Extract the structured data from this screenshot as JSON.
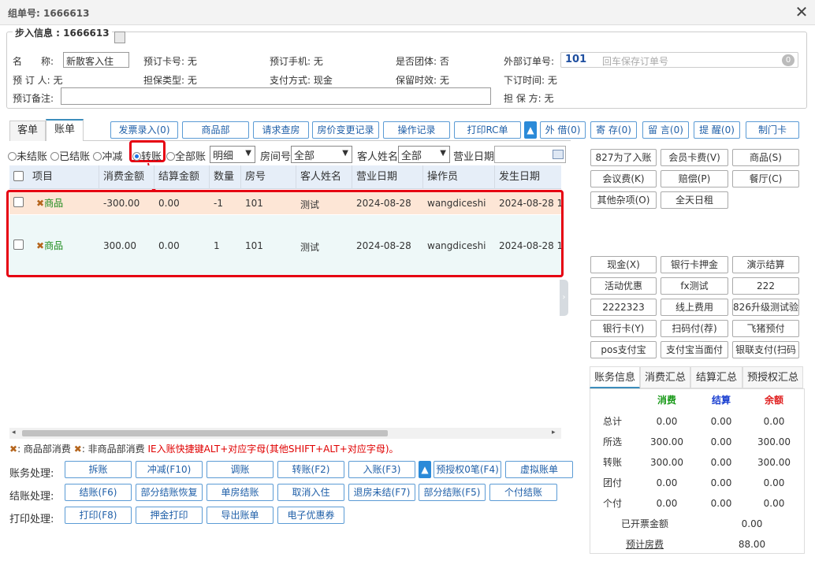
{
  "window": {
    "title": "组单号: 1666613",
    "close_glyph": "✕"
  },
  "checkin": {
    "legend": "步入信息 : 1666613",
    "name_label": "名　　称:",
    "name_value": "新散客入住",
    "card_label": "预订卡号: 无",
    "phone_label": "预订手机: 无",
    "group_label": "是否团体: 否",
    "ext_order_label": "外部订单号:",
    "ext_order_value": "101",
    "ext_order_placeholder": "回车保存订单号",
    "ext_order_badge": "0",
    "booker_label": "预 订 人: 无",
    "guarantee_type_label": "担保类型: 无",
    "pay_label": "支付方式: 现金",
    "retain_label": "保留时效: 无",
    "order_time_label": "下订时间: 无",
    "remark_label": "预订备注:",
    "guarantor_label": "担 保 方: 无"
  },
  "tabs": [
    {
      "label": "客单"
    },
    {
      "label": "账单"
    }
  ],
  "toolbar": [
    "发票录入(0)",
    "商品部",
    "请求查房",
    "房价变更记录",
    "操作记录",
    "打印RC单",
    "外 借(0)",
    "寄 存(0)",
    "留 言(0)",
    "提 醒(0)",
    "制门卡"
  ],
  "filters": {
    "radios": [
      "未结账",
      "已结账",
      "冲减",
      "转账",
      "全部账"
    ],
    "detail_select": "明细",
    "room_label": "房间号",
    "room_select": "全部",
    "guest_label": "客人姓名",
    "guest_select": "全部",
    "bizdate_label": "营业日期"
  },
  "grid": {
    "columns": [
      "项目",
      "消费金额",
      "结算金额",
      "数量",
      "房号",
      "客人姓名",
      "营业日期",
      "操作员",
      "发生日期"
    ],
    "rows": [
      {
        "item": "商品",
        "amount": "-300.00",
        "settle": "0.00",
        "qty": "-1",
        "room": "101",
        "guest": "测试",
        "bizdate": "2024-08-28",
        "operator": "wangdiceshi",
        "date": "2024-08-28 1"
      },
      {
        "item": "商品",
        "amount": "300.00",
        "settle": "0.00",
        "qty": "1",
        "room": "101",
        "guest": "测试",
        "bizdate": "2024-08-28",
        "operator": "wangdiceshi",
        "date": "2024-08-28 1"
      }
    ]
  },
  "hint": {
    "a": ": 商品部消费",
    "b": ": 非商品部消费",
    "c": "IE入账快捷键ALT+对应字母(其他SHIFT+ALT+对应字母)。"
  },
  "actions": {
    "account_label": "账务处理:",
    "account": [
      "拆账",
      "冲减(F10)",
      "调账",
      "转账(F2)",
      "入账(F3)",
      "预授权0笔(F4)",
      "虚拟账单"
    ],
    "settle_label": "结账处理:",
    "settle": [
      "结账(F6)",
      "部分结账恢复",
      "单房结账",
      "取消入住",
      "退房未结(F7)",
      "部分结账(F5)",
      "个付结账"
    ],
    "print_label": "打印处理:",
    "print": [
      "打印(F8)",
      "押金打印",
      "导出账单",
      "电子优惠券"
    ]
  },
  "right_buttons_top": [
    "827为了入账",
    "会员卡费(V)",
    "商品(S)",
    "会议费(K)",
    "赔偿(P)",
    "餐厅(C)",
    "其他杂项(O)",
    "全天日租"
  ],
  "right_buttons_pay": [
    "现金(X)",
    "银行卡押金",
    "演示结算",
    "活动优惠",
    "fx测试",
    "222",
    "2222323",
    "线上费用",
    "826升级测试验",
    "银行卡(Y)",
    "扫码付(荐)",
    "飞猪预付",
    "pos支付宝",
    "支付宝当面付",
    "银联支付(扫码"
  ],
  "summary": {
    "tabs": [
      "账务信息",
      "消费汇总",
      "结算汇总",
      "预授权汇总"
    ],
    "headers": [
      "消费",
      "结算",
      "余额"
    ],
    "header_colors": [
      "#1a9a1a",
      "#1a3fd0",
      "#e02020"
    ],
    "rows": [
      {
        "label": "总计",
        "vals": [
          "0.00",
          "0.00",
          "0.00"
        ]
      },
      {
        "label": "所选",
        "vals": [
          "300.00",
          "0.00",
          "300.00"
        ]
      },
      {
        "label": "转账",
        "vals": [
          "300.00",
          "0.00",
          "300.00"
        ]
      },
      {
        "label": "团付",
        "vals": [
          "0.00",
          "0.00",
          "0.00"
        ]
      },
      {
        "label": "个付",
        "vals": [
          "0.00",
          "0.00",
          "0.00"
        ]
      }
    ],
    "invoiced_label": "已开票金额",
    "invoiced_value": "0.00",
    "est_label": "预计房费",
    "est_value": "88.00"
  }
}
